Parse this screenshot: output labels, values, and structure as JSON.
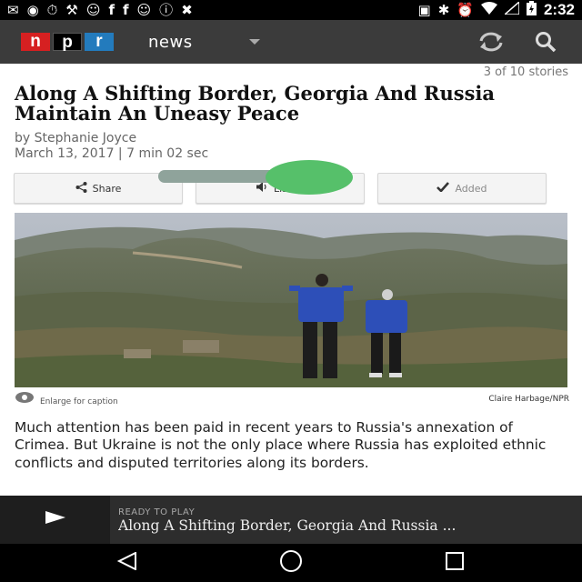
{
  "status_bar": {
    "time": "2:32",
    "left_icons": [
      "message-icon",
      "record-icon",
      "timer-icon",
      "wrench-icon",
      "smiley-icon",
      "facebook-icon",
      "facebook-icon",
      "smiley-icon",
      "info-icon",
      "no-sim-icon"
    ],
    "right_icons": [
      "lock-icon",
      "bluetooth-icon",
      "alarm-icon",
      "wifi-icon",
      "no-signal-icon",
      "battery-charging-icon"
    ]
  },
  "app_bar": {
    "logo_letters": [
      "n",
      "p",
      "r"
    ],
    "section_label": "news",
    "colors": {
      "n": "#d62021",
      "p": "#000000",
      "r": "#237bbd",
      "bar": "#3b3b3b"
    }
  },
  "article": {
    "story_count": "3 of 10 stories",
    "headline": "Along A Shifting Border, Georgia And Russia Maintain An Uneasy Peace",
    "byline": "by Stephanie Joyce",
    "meta": "March 13, 2017 | 7 min 02 sec",
    "actions": {
      "share_label": "Share",
      "listen_label": "Listen",
      "added_label": "Added"
    },
    "image": {
      "enlarge_label": "Enlarge for caption",
      "credit": "Claire Harbage/NPR"
    },
    "body": "Much attention has been paid in recent years to Russia's annexation of Crimea. But Ukraine is not the only place where Russia has exploited ethnic conflicts and disputed territories along its borders."
  },
  "player": {
    "status": "READY TO PLAY",
    "title": "Along A Shifting Border, Georgia And Russia ..."
  },
  "nav_bar": {
    "buttons": [
      "back-icon",
      "home-icon",
      "recents-icon"
    ]
  }
}
